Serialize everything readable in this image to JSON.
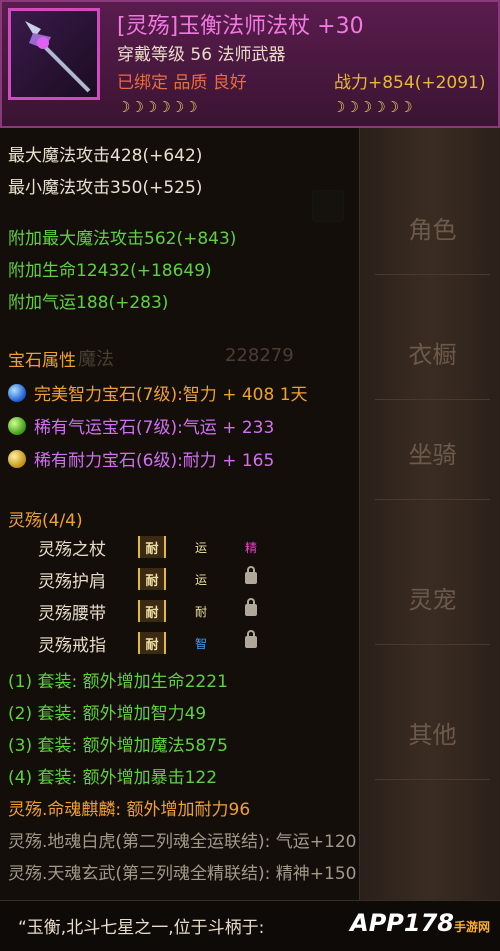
{
  "background_tabs": [
    "角色",
    "衣橱",
    "坐骑",
    "灵宠",
    "其他"
  ],
  "background_faded": {
    "label": "魔法",
    "value": "228279"
  },
  "item": {
    "title": "[灵殇]玉衡法师法杖",
    "enhance": "+30",
    "level_line": "穿戴等级 56  法师武器",
    "bind_line": "已绑定 品质 良好",
    "power": "战力+854(+2091)",
    "stars_left": "☽☽☽☽☽☽",
    "stars_right": "☽☽☽☽☽☽"
  },
  "base_stats": [
    "最大魔法攻击428(+642)",
    "最小魔法攻击350(+525)"
  ],
  "extra_stats": [
    "附加最大魔法攻击562(+843)",
    "附加生命12432(+18649)",
    "附加气运188(+283)"
  ],
  "gems": {
    "heading": "宝石属性",
    "items": [
      {
        "text": "完美智力宝石(7级):智力 + 408  1天",
        "color": "#f0a030",
        "gem": "blue"
      },
      {
        "text": "稀有气运宝石(7级):气运 + 233",
        "color": "#d070f0",
        "gem": "green"
      },
      {
        "text": "稀有耐力宝石(6级):耐力 + 165",
        "color": "#d070f0",
        "gem": "yellow"
      }
    ]
  },
  "suit": {
    "heading": "灵殇(4/4)",
    "pieces": [
      {
        "name": "灵殇之杖",
        "badge": "耐",
        "slot1": "运",
        "slot2": "精"
      },
      {
        "name": "灵殇护肩",
        "badge": "耐",
        "slot1": "运",
        "slot2": ""
      },
      {
        "name": "灵殇腰带",
        "badge": "耐",
        "slot1": "耐",
        "slot2": ""
      },
      {
        "name": "灵殇戒指",
        "badge": "耐",
        "slot1": "智",
        "slot2": ""
      }
    ],
    "bonuses": [
      "(1) 套装:  额外增加生命2221",
      "(2) 套装:  额外增加智力49",
      "(3) 套装:  额外增加魔法5875",
      "(4) 套装:  额外增加暴击122"
    ],
    "soul_bonus": "灵殇.命魂麒麟:  额外增加耐力96",
    "locked_bonuses": [
      "灵殇.地魂白虎(第二列魂全运联结):  气运+120",
      "灵殇.天魂玄武(第三列魂全精联结):  精神+150"
    ]
  },
  "quote": "“玉衡,北斗七星之一,位于斗柄于:",
  "watermark": {
    "main": "APP178",
    "sub": "手游网"
  }
}
